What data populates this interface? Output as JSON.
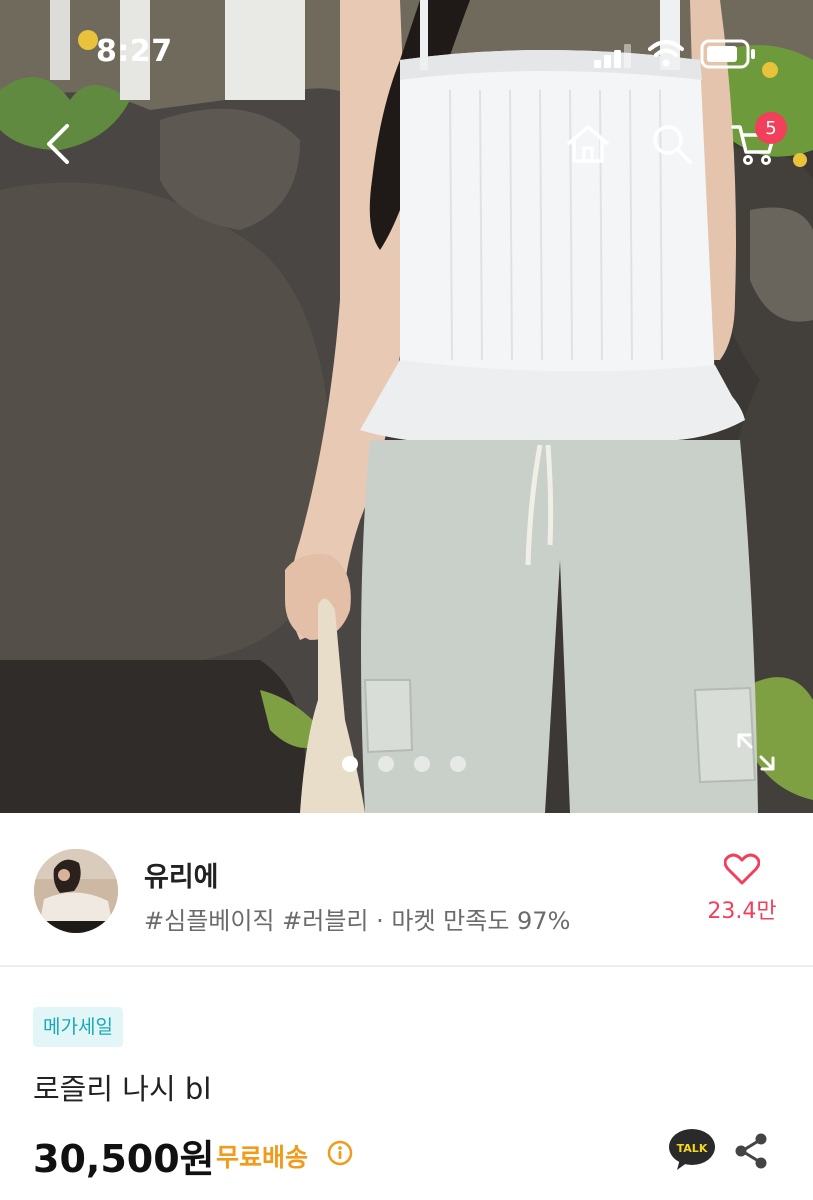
{
  "status_bar": {
    "time": "8:27"
  },
  "nav": {
    "back_icon": "chevron-left-icon",
    "home_icon": "home-icon",
    "search_icon": "search-icon",
    "cart_icon": "cart-icon",
    "cart_count": "5"
  },
  "gallery": {
    "total_images": 4,
    "current_index": 0
  },
  "shop": {
    "name": "유리에",
    "tags": "#심플베이직 #러블리 · 마켓 만족도 97%",
    "like_count": "23.4만"
  },
  "product": {
    "badge": "메가세일",
    "title": "로즐리 나시 bl",
    "price": "30,500원",
    "shipping": "무료배송"
  },
  "colors": {
    "accent_pink": "#f2405c",
    "shipping_orange": "#f29a1a",
    "badge_teal": "#1aa8b8"
  }
}
